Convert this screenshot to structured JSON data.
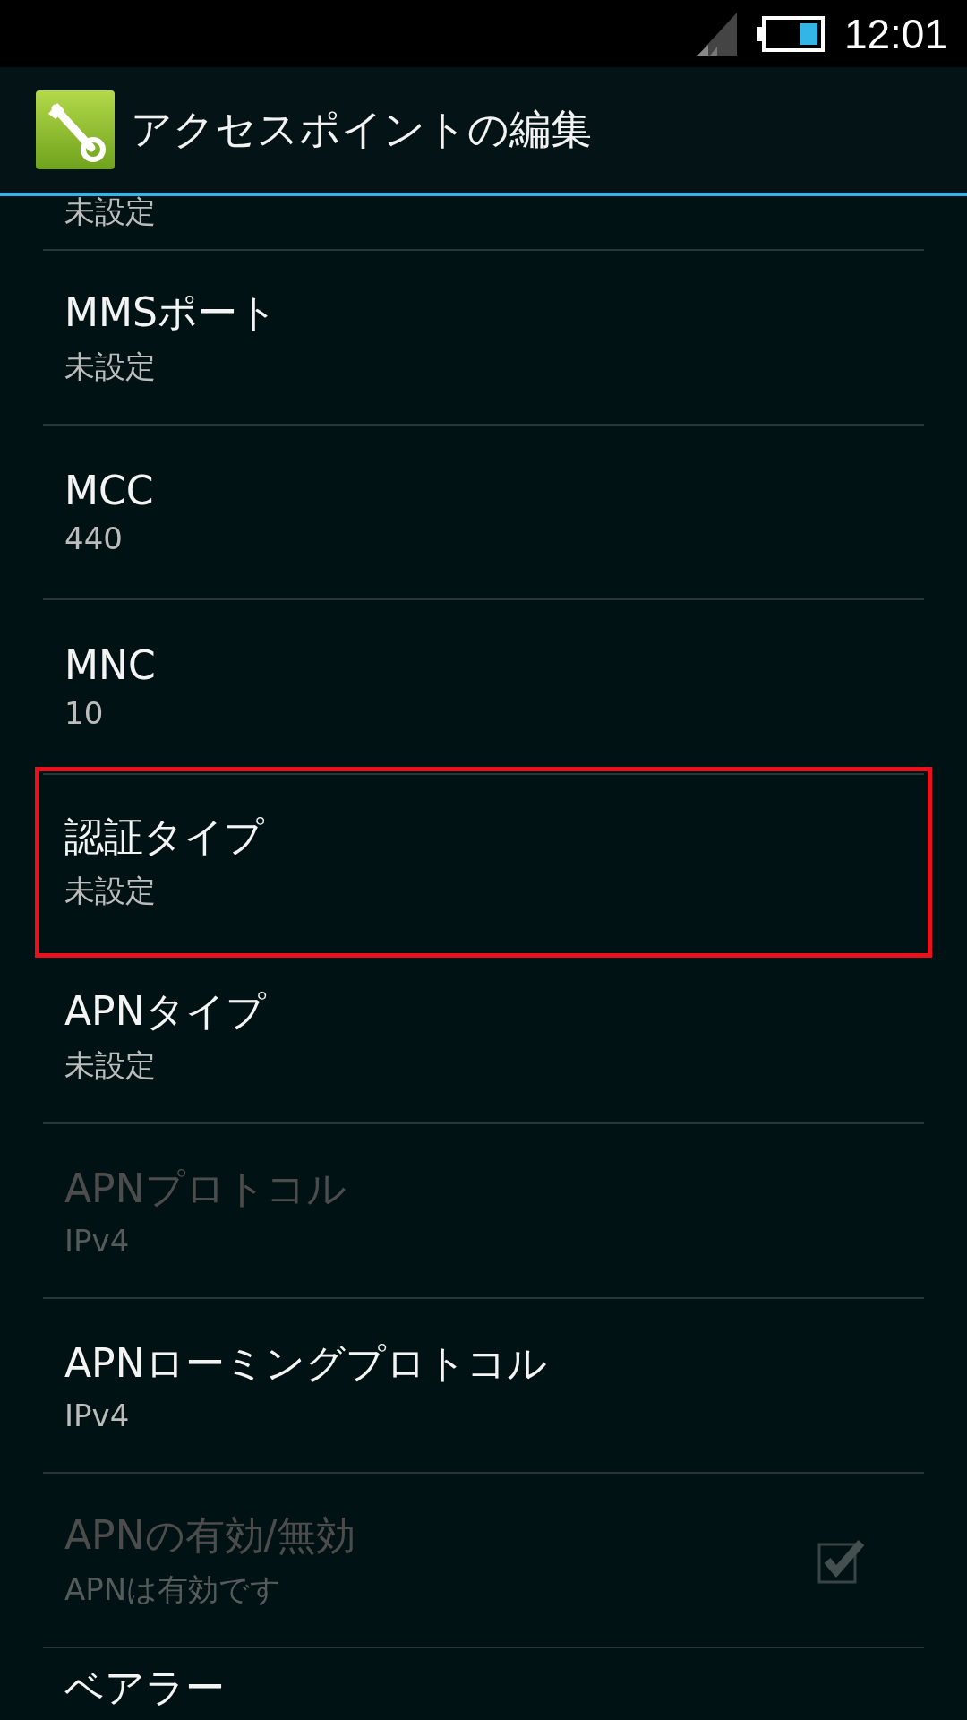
{
  "status_bar": {
    "time": "12:01"
  },
  "header": {
    "title": "アクセスポイントの編集"
  },
  "items": [
    {
      "kind": "cut_top",
      "summary": "未設定",
      "disabled": false,
      "highlighted": false
    },
    {
      "kind": "text",
      "title": "MMSポート",
      "summary": "未設定",
      "disabled": false,
      "highlighted": false
    },
    {
      "kind": "text",
      "title": "MCC",
      "summary": "440",
      "disabled": false,
      "highlighted": false
    },
    {
      "kind": "text",
      "title": "MNC",
      "summary": "10",
      "disabled": false,
      "highlighted": false
    },
    {
      "kind": "text",
      "title": "認証タイプ",
      "summary": "未設定",
      "disabled": false,
      "highlighted": true
    },
    {
      "kind": "text",
      "title": "APNタイプ",
      "summary": "未設定",
      "disabled": false,
      "highlighted": false
    },
    {
      "kind": "text",
      "title": "APNプロトコル",
      "summary": "IPv4",
      "disabled": true,
      "highlighted": false
    },
    {
      "kind": "text",
      "title": "APNローミングプロトコル",
      "summary": "IPv4",
      "disabled": false,
      "highlighted": false
    },
    {
      "kind": "checkbox",
      "title": "APNの有効/無効",
      "summary": "APNは有効です",
      "disabled": true,
      "highlighted": false,
      "checked": true
    },
    {
      "kind": "cut_bottom",
      "title": "ベアラー",
      "disabled": false,
      "highlighted": false
    }
  ]
}
